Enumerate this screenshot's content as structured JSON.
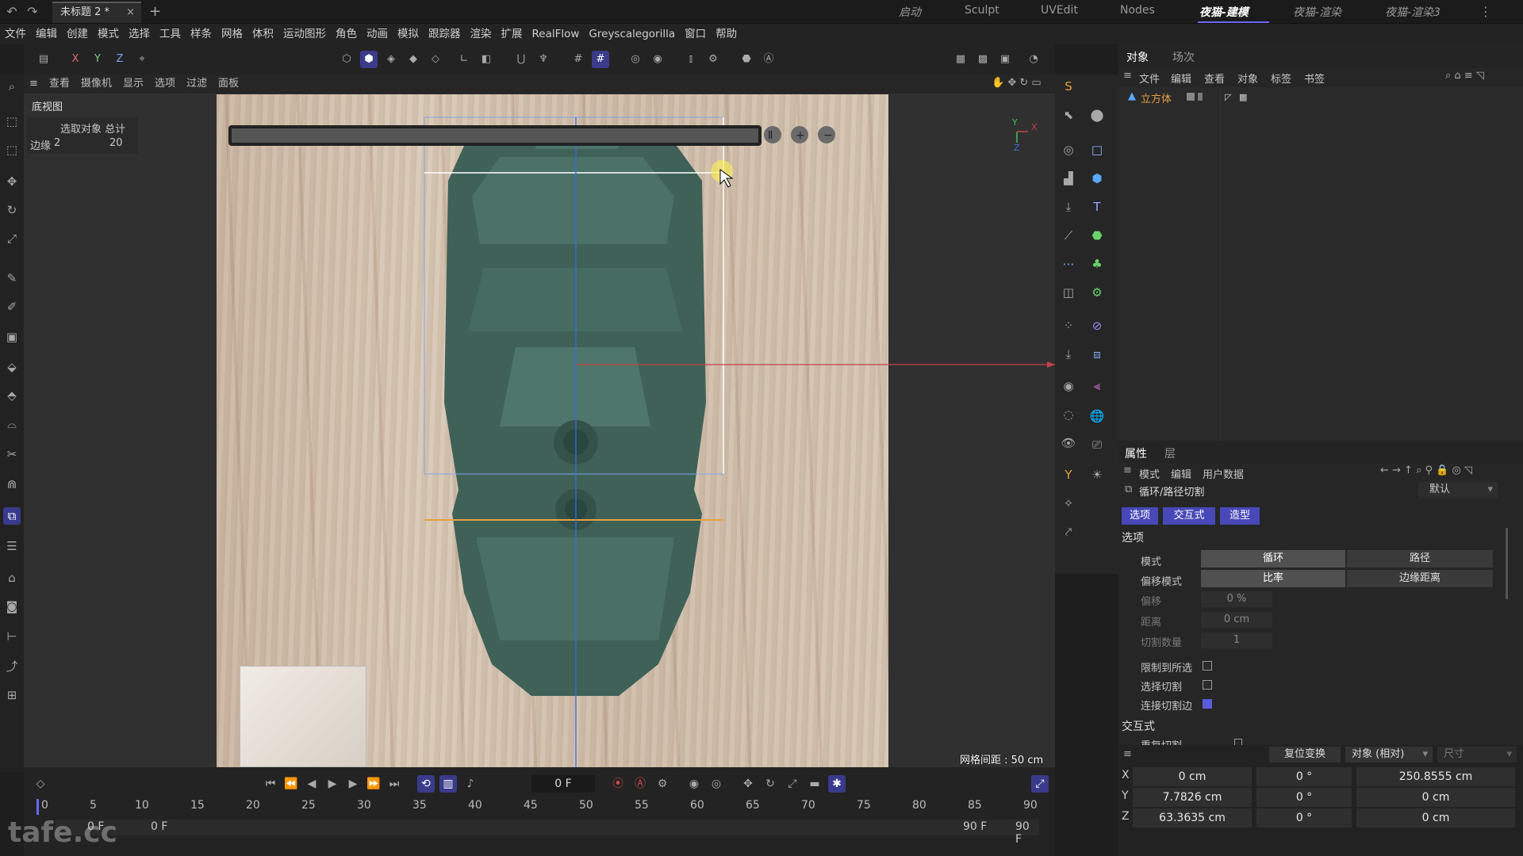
{
  "titlebar": {
    "doc_tab": "未标题 2 *",
    "close": "×",
    "plus": "+",
    "layouts": [
      "启动",
      "Sculpt",
      "UVEdit",
      "Nodes",
      "夜猫-建模",
      "夜猫-渲染",
      "夜猫-渲染3"
    ],
    "active_layout": "夜猫-建模"
  },
  "menu": [
    "文件",
    "编辑",
    "创建",
    "模式",
    "选择",
    "工具",
    "样条",
    "网格",
    "体积",
    "运动图形",
    "角色",
    "动画",
    "模拟",
    "跟踪器",
    "渲染",
    "扩展",
    "RealFlow",
    "Greyscalegorilla",
    "窗口",
    "帮助"
  ],
  "axis_toggles": [
    "X",
    "Y",
    "Z"
  ],
  "viewport": {
    "menu": [
      "查看",
      "摄像机",
      "显示",
      "选项",
      "过滤",
      "面板"
    ],
    "name": "底视图",
    "hud_header": "选取对象 总计",
    "hud_label": "边缘",
    "hud_value1": "2",
    "hud_value2": "20",
    "grid_distance": "网格间距 : 50 cm",
    "axis_y": "Y",
    "axis_x": "X",
    "axis_z": "Z"
  },
  "objects_panel": {
    "tabs": [
      "对象",
      "场次"
    ],
    "menu": [
      "文件",
      "编辑",
      "查看",
      "对象",
      "标签",
      "书签"
    ],
    "object_name": "立方体"
  },
  "attributes": {
    "tabs": [
      "属性",
      "层"
    ],
    "menu": [
      "模式",
      "编辑",
      "用户数据"
    ],
    "tool_name": "循环/路径切割",
    "preset": "默认",
    "sub_tabs": [
      "选项",
      "交互式",
      "造型"
    ],
    "section_options": "选项",
    "mode_label": "模式",
    "mode_options": [
      "循环",
      "路径"
    ],
    "offset_mode_label": "偏移模式",
    "offset_mode_options": [
      "比率",
      "边缘距离"
    ],
    "offset_label": "偏移",
    "offset_value": "0 %",
    "distance_label": "距离",
    "distance_value": "0 cm",
    "cuts_label": "切割数量",
    "cuts_value": "1",
    "restrict_label": "限制到所选",
    "select_cut_label": "选择切割",
    "connect_label": "连接切割边",
    "section_interactive": "交互式",
    "repeat_label": "重复切割"
  },
  "coords": {
    "reset_button": "复位变换",
    "object_mode": "对象 (相对)",
    "size_label": "尺寸",
    "rows": [
      {
        "axis": "X",
        "pos": "0 cm",
        "rot": "0 °",
        "size": "250.8555 cm"
      },
      {
        "axis": "Y",
        "pos": "7.7826 cm",
        "rot": "0 °",
        "size": "0 cm"
      },
      {
        "axis": "Z",
        "pos": "63.3635 cm",
        "rot": "0 °",
        "size": "0 cm"
      }
    ]
  },
  "timeline": {
    "current_frame": "0 F",
    "ticks": [
      "0",
      "5",
      "10",
      "15",
      "20",
      "25",
      "30",
      "35",
      "40",
      "45",
      "50",
      "55",
      "60",
      "65",
      "70",
      "75",
      "80",
      "85",
      "90"
    ],
    "start_frame": "0 F",
    "start_frame2": "0 F",
    "end_frame": "90 F",
    "end_frame2": "90 F"
  },
  "watermark": "tafe.cc",
  "colors": {
    "accent": "#5a5adc",
    "model": "#3f6158",
    "x_axis": "#c4424a",
    "y_axis": "#3cc25a",
    "z_axis": "#3a6cd6",
    "cut_line": "#e8a040"
  }
}
